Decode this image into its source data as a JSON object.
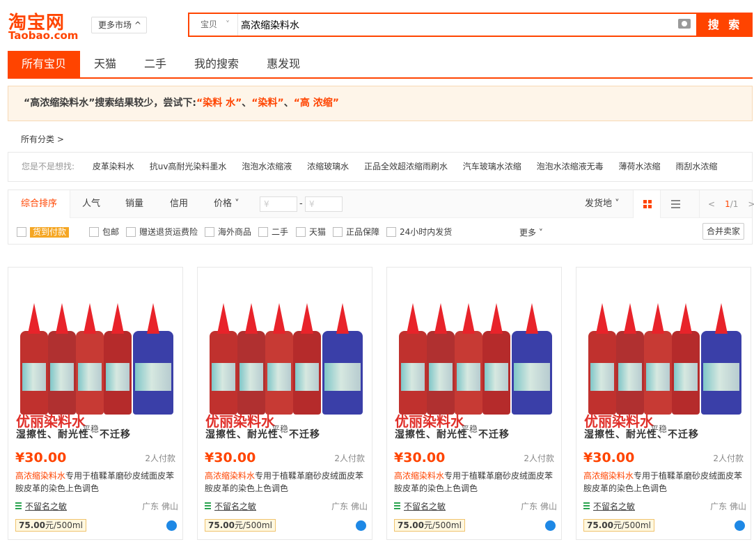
{
  "header": {
    "logo_cn": "淘宝网",
    "logo_en": "Taobao.com",
    "market_label": "更多市场 ^",
    "search_category": "宝贝",
    "search_value": "高浓缩染料水",
    "search_button": "搜 索"
  },
  "tabs": [
    "所有宝贝",
    "天猫",
    "二手",
    "我的搜索",
    "惠发现"
  ],
  "notice": {
    "prefix": "“高浓缩染料水”搜索结果较少，尝试下:",
    "s1": "“染料 水”",
    "sep1": "、",
    "s2": "“染料”",
    "sep2": "、",
    "s3": "“高 浓缩”"
  },
  "all_category": "所有分类 >",
  "suggest": {
    "label": "您是不是想找:",
    "keywords": [
      "皮革染料水",
      "抗uv高耐光染料墨水",
      "泡泡水浓缩液",
      "浓缩玻璃水",
      "正品全效超浓缩雨刷水",
      "汽车玻璃水浓缩",
      "泡泡水浓缩液无毒",
      "薄荷水浓缩",
      "雨刮水浓缩"
    ]
  },
  "sort": {
    "items": [
      "综合排序",
      "人气",
      "销量",
      "信用",
      "价格 ˅"
    ],
    "price_min_placeholder": "¥",
    "price_max_placeholder": "¥",
    "price_dash": "-",
    "ship_from": "发货地 ˅",
    "page_current": "1",
    "page_total": "/1",
    "prev": "<",
    "next": ">"
  },
  "filters": {
    "items": [
      "货到付款",
      "包邮",
      "赠送退货运费险",
      "海外商品",
      "二手",
      "天猫",
      "正品保障",
      "24小时内发货"
    ],
    "more": "更多 ˅",
    "merge": "合并卖家"
  },
  "products": [
    {
      "price": "¥30.00",
      "sold": "2人付款",
      "title_hl": "高浓缩染料水",
      "title_rest": "专用于植鞣革磨砂皮绒面皮苯胺皮革的染色上色调色",
      "shop": "不留名之敏",
      "location": "广东 佛山",
      "unit_price": "75.00",
      "unit_rest": "元/500ml",
      "ad1": "优丽染料水",
      "ad2": "湿擦性、耐光性、不迁移",
      "ad_wm": "平稳"
    },
    {
      "price": "¥30.00",
      "sold": "2人付款",
      "title_hl": "高浓缩染料水",
      "title_rest": "专用于植鞣革磨砂皮绒面皮苯胺皮革的染色上色调色",
      "shop": "不留名之敏",
      "location": "广东 佛山",
      "unit_price": "75.00",
      "unit_rest": "元/500ml",
      "ad1": "优丽染料水",
      "ad2": "湿擦性、耐光性、不迁移",
      "ad_wm": "平稳"
    },
    {
      "price": "¥30.00",
      "sold": "2人付款",
      "title_hl": "高浓缩染料水",
      "title_rest": "专用于植鞣革磨砂皮绒面皮苯胺皮革的染色上色调色",
      "shop": "不留名之敏",
      "location": "广东 佛山",
      "unit_price": "75.00",
      "unit_rest": "元/500ml",
      "ad1": "优丽染料水",
      "ad2": "湿擦性、耐光性、不迁移",
      "ad_wm": "平稳"
    },
    {
      "price": "¥30.00",
      "sold": "2人付款",
      "title_hl": "高浓缩染料水",
      "title_rest": "专用于植鞣革磨砂皮绒面皮苯胺皮革的染色上色调色",
      "shop": "不留名之敏",
      "location": "广东 佛山",
      "unit_price": "75.00",
      "unit_rest": "元/500ml",
      "ad1": "优丽染料水",
      "ad2": "湿擦性、耐光性、不迁移",
      "ad_wm": "平稳"
    }
  ],
  "colors": {
    "accent": "#ff4400",
    "notice_bg": "#fef5e9",
    "cod_tag": "#f5a623"
  }
}
